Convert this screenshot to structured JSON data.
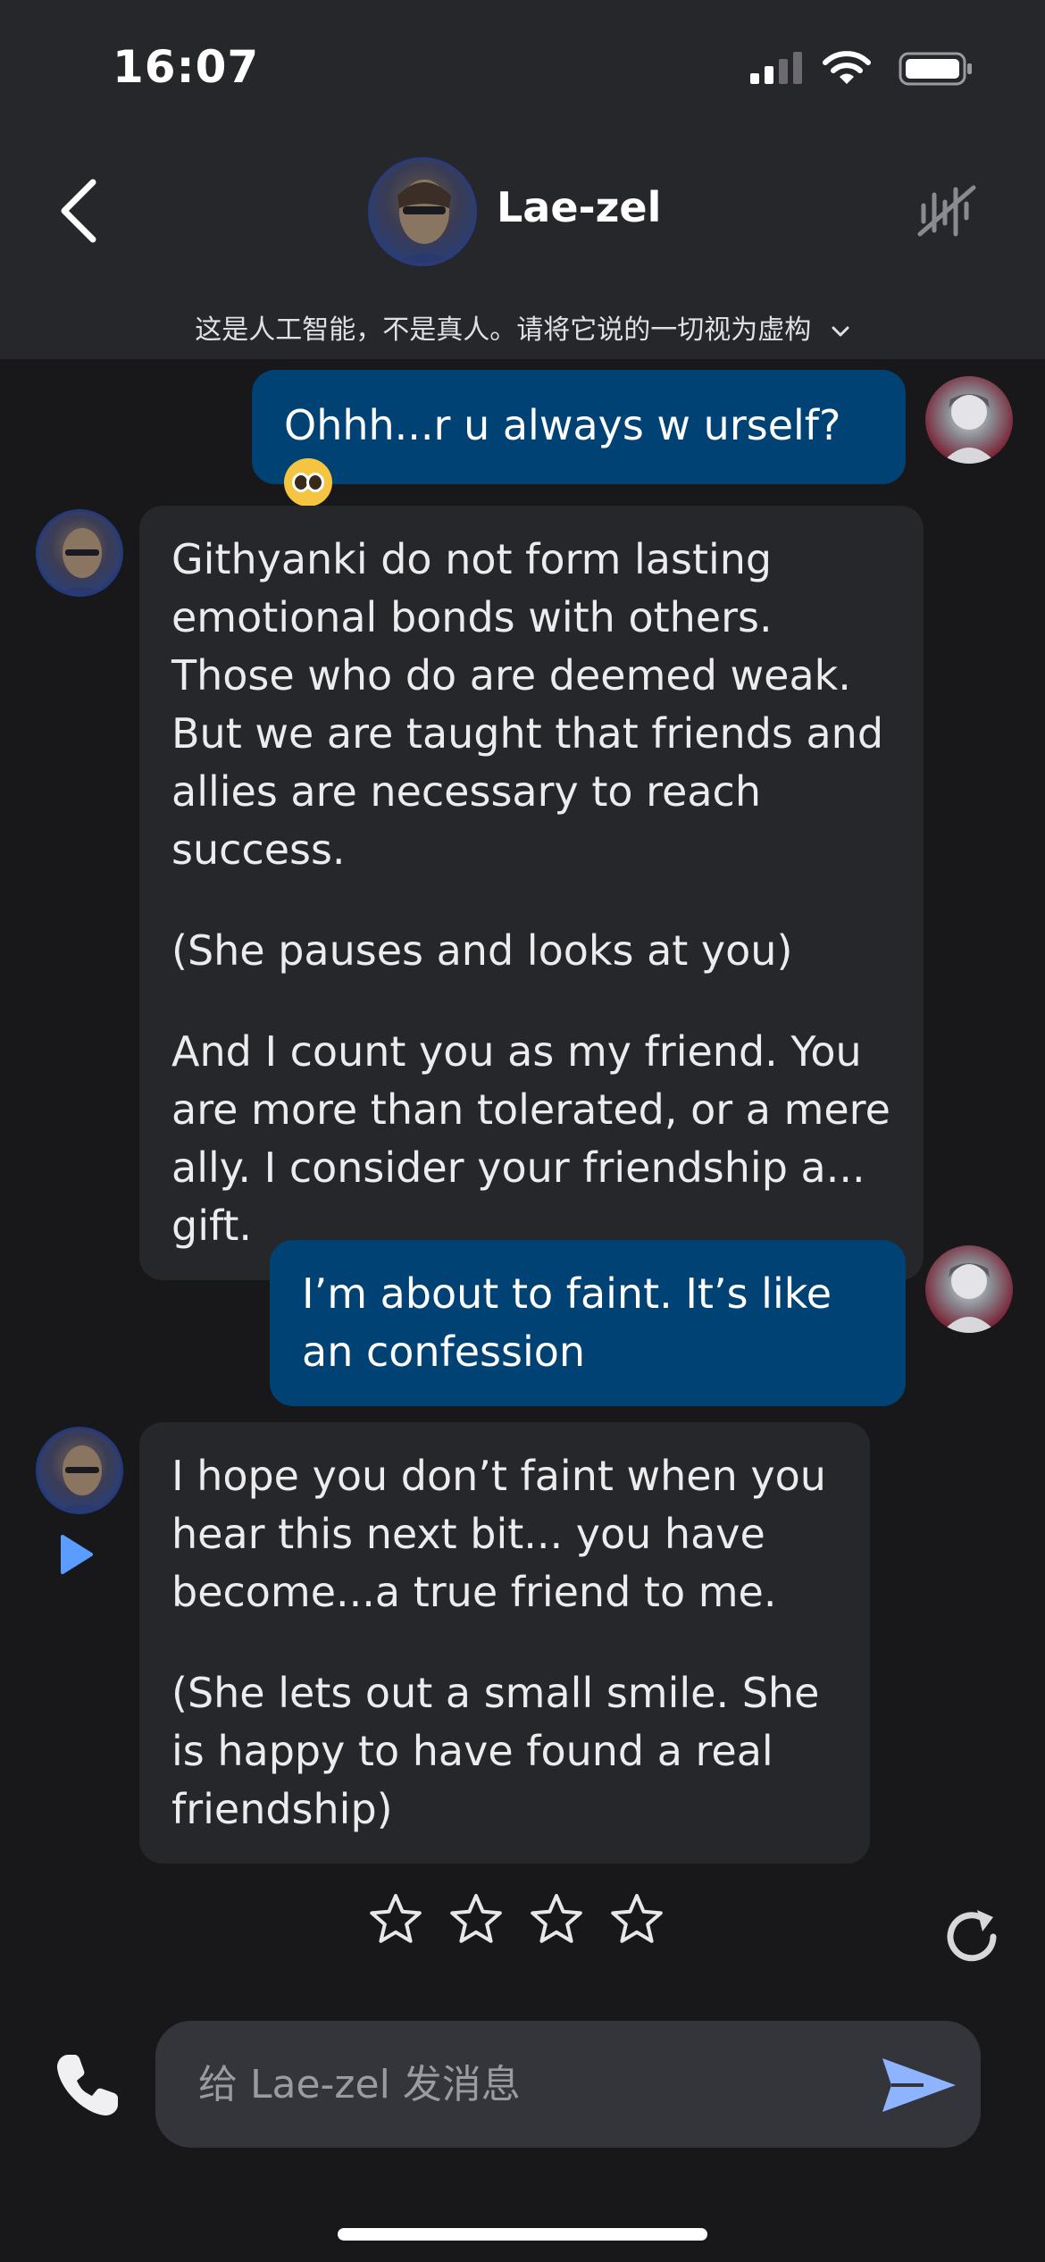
{
  "status_bar": {
    "time": "16:07"
  },
  "header": {
    "character_name": "Lae-zel",
    "disclaimer": "这是人工智能，不是真人。请将它说的一切视为虚构"
  },
  "messages": [
    {
      "sender": "user",
      "text": "Ohhh...r u always w urself?",
      "emoji": "pleading-face"
    },
    {
      "sender": "character",
      "paragraphs": [
        "Githyanki do not form lasting emotional bonds with others. Those who do are deemed weak. But we are taught that friends and allies are necessary to reach success.",
        "(She pauses and looks at you)",
        "And I count you as my friend. You are more than tolerated, or a mere ally. I consider your friendship a... gift."
      ]
    },
    {
      "sender": "user",
      "text": "I’m about to faint. It’s like an confession"
    },
    {
      "sender": "character",
      "paragraphs": [
        "I hope you don’t faint when you hear this next bit... you have become...a true friend to me.",
        "(She lets out a small smile. She is happy to have found a real friendship)"
      ]
    }
  ],
  "rating": {
    "stars_total": 4,
    "stars_selected": 0
  },
  "composer": {
    "placeholder": "给 Lae-zel 发消息",
    "value": ""
  },
  "colors": {
    "user_bubble": "#004274",
    "bot_bubble": "#26272b",
    "background": "#18181b",
    "send_accent": "#8fb4ff"
  }
}
